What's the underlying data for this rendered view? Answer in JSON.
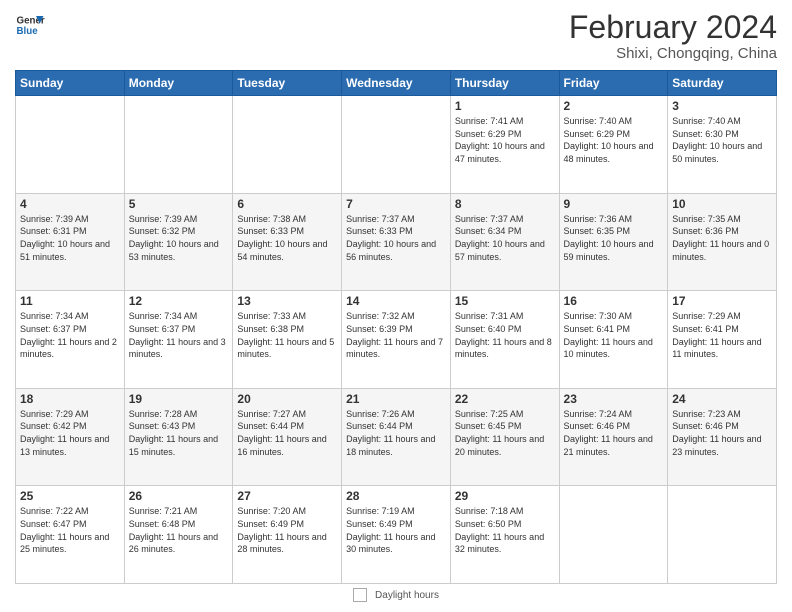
{
  "header": {
    "logo_general": "General",
    "logo_blue": "Blue",
    "month": "February 2024",
    "location": "Shixi, Chongqing, China"
  },
  "days_of_week": [
    "Sunday",
    "Monday",
    "Tuesday",
    "Wednesday",
    "Thursday",
    "Friday",
    "Saturday"
  ],
  "weeks": [
    [
      {
        "day": "",
        "info": ""
      },
      {
        "day": "",
        "info": ""
      },
      {
        "day": "",
        "info": ""
      },
      {
        "day": "",
        "info": ""
      },
      {
        "day": "1",
        "info": "Sunrise: 7:41 AM\nSunset: 6:29 PM\nDaylight: 10 hours and 47 minutes."
      },
      {
        "day": "2",
        "info": "Sunrise: 7:40 AM\nSunset: 6:29 PM\nDaylight: 10 hours and 48 minutes."
      },
      {
        "day": "3",
        "info": "Sunrise: 7:40 AM\nSunset: 6:30 PM\nDaylight: 10 hours and 50 minutes."
      }
    ],
    [
      {
        "day": "4",
        "info": "Sunrise: 7:39 AM\nSunset: 6:31 PM\nDaylight: 10 hours and 51 minutes."
      },
      {
        "day": "5",
        "info": "Sunrise: 7:39 AM\nSunset: 6:32 PM\nDaylight: 10 hours and 53 minutes."
      },
      {
        "day": "6",
        "info": "Sunrise: 7:38 AM\nSunset: 6:33 PM\nDaylight: 10 hours and 54 minutes."
      },
      {
        "day": "7",
        "info": "Sunrise: 7:37 AM\nSunset: 6:33 PM\nDaylight: 10 hours and 56 minutes."
      },
      {
        "day": "8",
        "info": "Sunrise: 7:37 AM\nSunset: 6:34 PM\nDaylight: 10 hours and 57 minutes."
      },
      {
        "day": "9",
        "info": "Sunrise: 7:36 AM\nSunset: 6:35 PM\nDaylight: 10 hours and 59 minutes."
      },
      {
        "day": "10",
        "info": "Sunrise: 7:35 AM\nSunset: 6:36 PM\nDaylight: 11 hours and 0 minutes."
      }
    ],
    [
      {
        "day": "11",
        "info": "Sunrise: 7:34 AM\nSunset: 6:37 PM\nDaylight: 11 hours and 2 minutes."
      },
      {
        "day": "12",
        "info": "Sunrise: 7:34 AM\nSunset: 6:37 PM\nDaylight: 11 hours and 3 minutes."
      },
      {
        "day": "13",
        "info": "Sunrise: 7:33 AM\nSunset: 6:38 PM\nDaylight: 11 hours and 5 minutes."
      },
      {
        "day": "14",
        "info": "Sunrise: 7:32 AM\nSunset: 6:39 PM\nDaylight: 11 hours and 7 minutes."
      },
      {
        "day": "15",
        "info": "Sunrise: 7:31 AM\nSunset: 6:40 PM\nDaylight: 11 hours and 8 minutes."
      },
      {
        "day": "16",
        "info": "Sunrise: 7:30 AM\nSunset: 6:41 PM\nDaylight: 11 hours and 10 minutes."
      },
      {
        "day": "17",
        "info": "Sunrise: 7:29 AM\nSunset: 6:41 PM\nDaylight: 11 hours and 11 minutes."
      }
    ],
    [
      {
        "day": "18",
        "info": "Sunrise: 7:29 AM\nSunset: 6:42 PM\nDaylight: 11 hours and 13 minutes."
      },
      {
        "day": "19",
        "info": "Sunrise: 7:28 AM\nSunset: 6:43 PM\nDaylight: 11 hours and 15 minutes."
      },
      {
        "day": "20",
        "info": "Sunrise: 7:27 AM\nSunset: 6:44 PM\nDaylight: 11 hours and 16 minutes."
      },
      {
        "day": "21",
        "info": "Sunrise: 7:26 AM\nSunset: 6:44 PM\nDaylight: 11 hours and 18 minutes."
      },
      {
        "day": "22",
        "info": "Sunrise: 7:25 AM\nSunset: 6:45 PM\nDaylight: 11 hours and 20 minutes."
      },
      {
        "day": "23",
        "info": "Sunrise: 7:24 AM\nSunset: 6:46 PM\nDaylight: 11 hours and 21 minutes."
      },
      {
        "day": "24",
        "info": "Sunrise: 7:23 AM\nSunset: 6:46 PM\nDaylight: 11 hours and 23 minutes."
      }
    ],
    [
      {
        "day": "25",
        "info": "Sunrise: 7:22 AM\nSunset: 6:47 PM\nDaylight: 11 hours and 25 minutes."
      },
      {
        "day": "26",
        "info": "Sunrise: 7:21 AM\nSunset: 6:48 PM\nDaylight: 11 hours and 26 minutes."
      },
      {
        "day": "27",
        "info": "Sunrise: 7:20 AM\nSunset: 6:49 PM\nDaylight: 11 hours and 28 minutes."
      },
      {
        "day": "28",
        "info": "Sunrise: 7:19 AM\nSunset: 6:49 PM\nDaylight: 11 hours and 30 minutes."
      },
      {
        "day": "29",
        "info": "Sunrise: 7:18 AM\nSunset: 6:50 PM\nDaylight: 11 hours and 32 minutes."
      },
      {
        "day": "",
        "info": ""
      },
      {
        "day": "",
        "info": ""
      }
    ]
  ],
  "legend": {
    "daylight_label": "Daylight hours"
  }
}
